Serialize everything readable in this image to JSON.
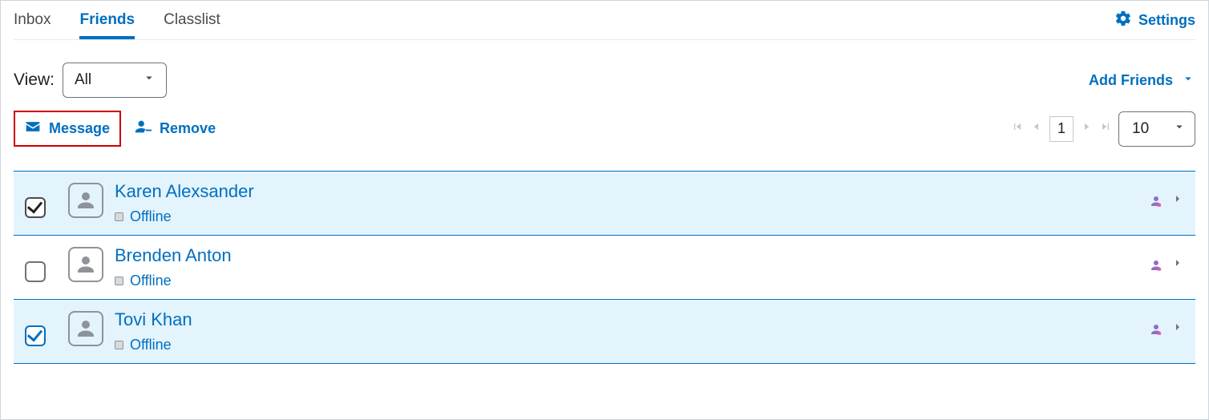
{
  "tabs": {
    "items": [
      {
        "label": "Inbox",
        "active": false
      },
      {
        "label": "Friends",
        "active": true
      },
      {
        "label": "Classlist",
        "active": false
      }
    ],
    "settings_label": "Settings"
  },
  "view": {
    "label": "View:",
    "selected": "All"
  },
  "add_friends_label": "Add Friends",
  "actions": {
    "message": "Message",
    "remove": "Remove"
  },
  "pagination": {
    "page": "1",
    "page_size": "10"
  },
  "friends": [
    {
      "name": "Karen Alexsander",
      "status": "Offline",
      "checked": true,
      "check_variant": "dark"
    },
    {
      "name": "Brenden Anton",
      "status": "Offline",
      "checked": false,
      "check_variant": ""
    },
    {
      "name": "Tovi Khan",
      "status": "Offline",
      "checked": true,
      "check_variant": "blue"
    }
  ]
}
